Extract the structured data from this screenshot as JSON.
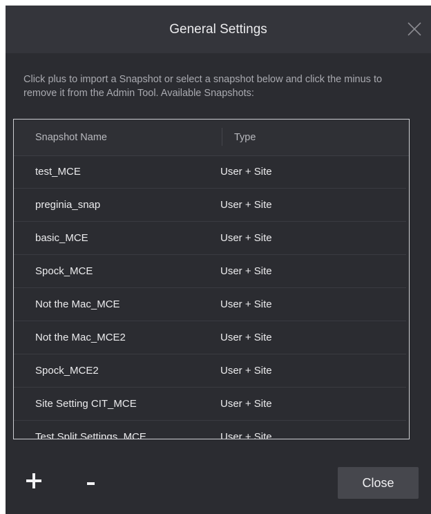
{
  "dialog": {
    "title": "General Settings",
    "close_icon": "close-x-icon"
  },
  "intro": "Click plus to import a Snapshot or select a snapshot below and click the minus to remove it from the Admin Tool. Available Snapshots:",
  "table": {
    "columns": [
      "Snapshot Name",
      "Type"
    ],
    "rows": [
      {
        "name": "test_MCE",
        "type": "User + Site"
      },
      {
        "name": "preginia_snap",
        "type": "User + Site"
      },
      {
        "name": "basic_MCE",
        "type": "User + Site"
      },
      {
        "name": "Spock_MCE",
        "type": "User + Site"
      },
      {
        "name": "Not the Mac_MCE",
        "type": "User + Site"
      },
      {
        "name": "Not the Mac_MCE2",
        "type": "User + Site"
      },
      {
        "name": "Spock_MCE2",
        "type": "User + Site"
      },
      {
        "name": "Site Setting CIT_MCE",
        "type": "User + Site"
      },
      {
        "name": "Test Split Settings_MCE",
        "type": "User + Site"
      }
    ]
  },
  "footer": {
    "add_icon": "plus-icon",
    "remove_icon": "minus-icon",
    "close_label": "Close"
  },
  "colors": {
    "dialog_bg": "#2b2c31",
    "titlebar_bg": "#34353b",
    "button_bg": "#46474d",
    "text": "#ececee"
  }
}
